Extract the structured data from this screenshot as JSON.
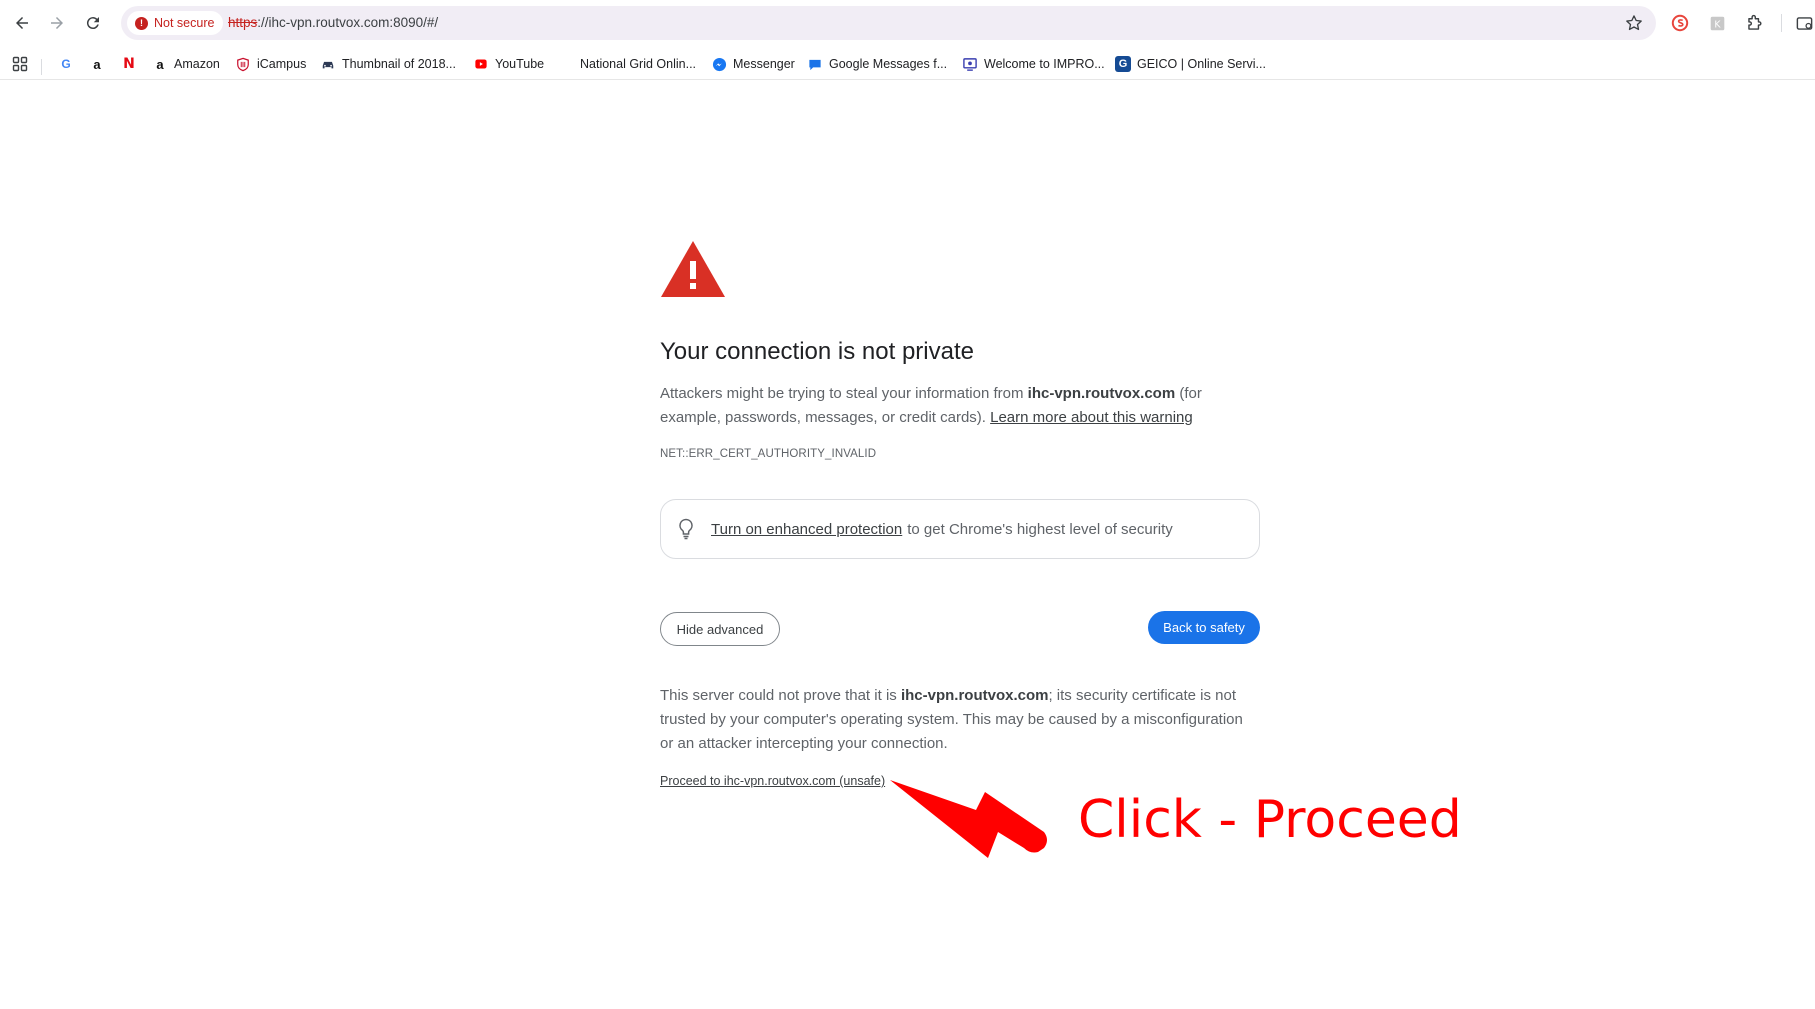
{
  "browser": {
    "security_chip": "Not secure",
    "url_scheme": "https",
    "url_rest": "://ihc-vpn.routvox.com:8090/#/"
  },
  "bookmarks": [
    {
      "label": "",
      "icon": "google-icon"
    },
    {
      "label": "",
      "icon": "amazon-icon"
    },
    {
      "label": "",
      "icon": "netflix-icon"
    },
    {
      "label": "Amazon",
      "icon": "amazon-icon"
    },
    {
      "label": "iCampus",
      "icon": "shield-icon"
    },
    {
      "label": "Thumbnail of 2018...",
      "icon": "car-icon"
    },
    {
      "label": "YouTube",
      "icon": "youtube-icon"
    },
    {
      "label": "National Grid Onlin...",
      "icon": "blank-icon"
    },
    {
      "label": "Messenger",
      "icon": "messenger-icon"
    },
    {
      "label": "Google Messages f...",
      "icon": "messages-icon"
    },
    {
      "label": "Welcome to IMPRO...",
      "icon": "monitor-icon"
    },
    {
      "label": "GEICO | Online Servi...",
      "icon": "geico-icon"
    }
  ],
  "interstitial": {
    "heading": "Your connection is not private",
    "p1_before": "Attackers might be trying to steal your information from ",
    "p1_domain": "ihc-vpn.routvox.com",
    "p1_after": " (for example, passwords, messages, or credit cards). ",
    "p1_link": "Learn more about this warning",
    "error_code": "NET::ERR_CERT_AUTHORITY_INVALID",
    "ep_link": "Turn on enhanced protection",
    "ep_text": "to get Chrome's highest level of security",
    "hide_advanced": "Hide advanced",
    "back_to_safety": "Back to safety",
    "p2_before": "This server could not prove that it is ",
    "p2_domain": "ihc-vpn.routvox.com",
    "p2_after": "; its security certificate is not trusted by your computer's operating system. This may be caused by a misconfiguration or an attacker intercepting your connection.",
    "proceed_link": "Proceed to ihc-vpn.routvox.com (unsafe)"
  },
  "annotation": {
    "text": "Click - Proceed",
    "color": "#ff0000"
  },
  "colors": {
    "warning_red": "#d93025",
    "primary_blue": "#1a73e8",
    "omnibox_bg": "#f1edf5"
  }
}
